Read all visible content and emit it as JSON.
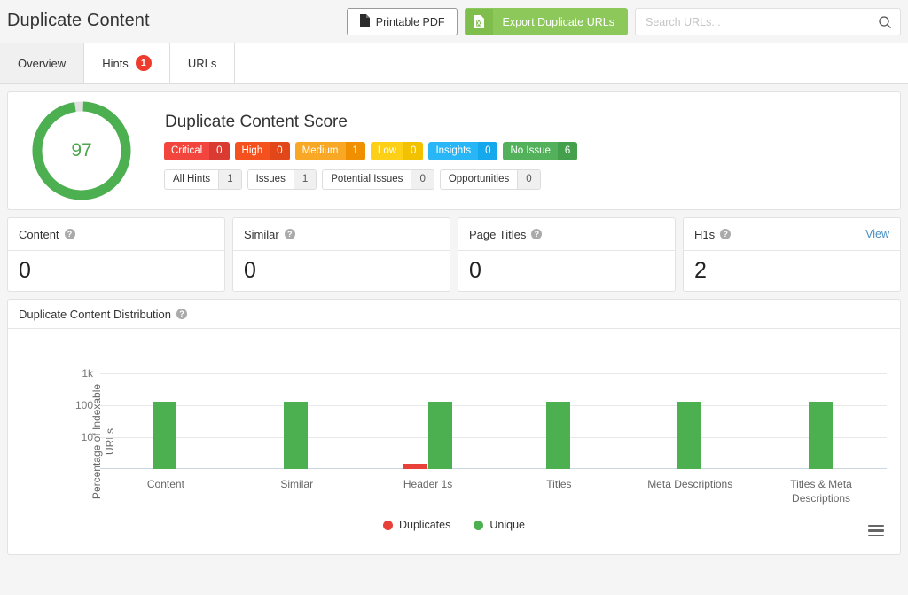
{
  "header": {
    "title": "Duplicate Content",
    "printable_pdf_label": "Printable PDF",
    "export_label": "Export Duplicate URLs",
    "search_placeholder": "Search URLs...",
    "search_value": ""
  },
  "tabs": [
    {
      "label": "Overview",
      "badge": null,
      "active": true
    },
    {
      "label": "Hints",
      "badge": "1",
      "active": false
    },
    {
      "label": "URLs",
      "badge": null,
      "active": false
    }
  ],
  "score": {
    "heading": "Duplicate Content Score",
    "value": "97",
    "percent": 97,
    "ring_color": "#4caf50",
    "ring_track_color": "#e0e0e0",
    "badges": [
      {
        "label": "Critical",
        "count": "0",
        "color": "#f2453d",
        "count_color": "#d93a32"
      },
      {
        "label": "High",
        "count": "0",
        "color": "#f4511e",
        "count_color": "#e2471a"
      },
      {
        "label": "Medium",
        "count": "1",
        "color": "#f9a825",
        "count_color": "#f09000"
      },
      {
        "label": "Low",
        "count": "0",
        "color": "#fdd017",
        "count_color": "#f2c200"
      },
      {
        "label": "Insights",
        "count": "0",
        "color": "#29b6f6",
        "count_color": "#16a8ec"
      },
      {
        "label": "No Issue",
        "count": "6",
        "color": "#52b15a",
        "count_color": "#45a04d"
      }
    ],
    "pills": [
      {
        "label": "All Hints",
        "count": "1"
      },
      {
        "label": "Issues",
        "count": "1"
      },
      {
        "label": "Potential Issues",
        "count": "0"
      },
      {
        "label": "Opportunities",
        "count": "0"
      }
    ]
  },
  "metrics": [
    {
      "title": "Content",
      "value": "0",
      "help": "?",
      "view": null
    },
    {
      "title": "Similar",
      "value": "0",
      "help": "?",
      "view": null
    },
    {
      "title": "Page Titles",
      "value": "0",
      "help": "?",
      "view": null
    },
    {
      "title": "H1s",
      "value": "2",
      "help": "?",
      "view": "View"
    }
  ],
  "chart_panel": {
    "title": "Duplicate Content Distribution",
    "help": "?"
  },
  "chart_data": {
    "type": "bar",
    "title": "Duplicate Content Distribution",
    "xlabel": "",
    "ylabel": "Percentage of Indexable\nURLs",
    "yscale": "log",
    "ylim": [
      1,
      1000
    ],
    "yticks": [
      1000,
      100,
      10
    ],
    "ytick_labels": [
      "1k",
      "100",
      "10"
    ],
    "grid": true,
    "legend_position": "bottom",
    "categories": [
      "Content",
      "Similar",
      "Header 1s",
      "Titles",
      "Meta Descriptions",
      "Titles & Meta Descriptions"
    ],
    "series": [
      {
        "name": "Duplicates",
        "color": "#e8413a",
        "values": [
          0,
          0,
          1.5,
          0,
          0,
          0
        ]
      },
      {
        "name": "Unique",
        "color": "#4caf50",
        "values": [
          130,
          130,
          130,
          130,
          130,
          130
        ]
      }
    ]
  },
  "chart_menu": {
    "name": "hamburger-menu"
  }
}
